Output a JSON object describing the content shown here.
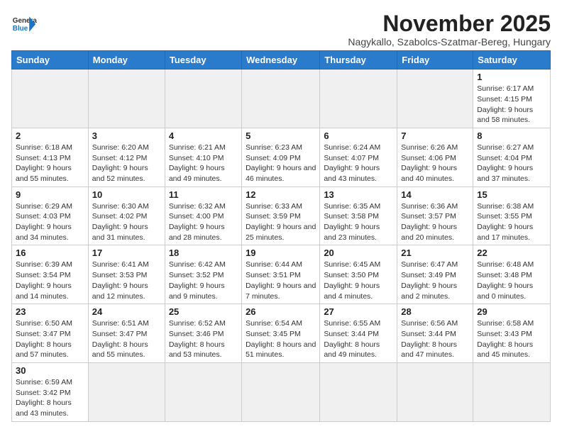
{
  "logo": {
    "text_general": "General",
    "text_blue": "Blue"
  },
  "title": "November 2025",
  "subtitle": "Nagykallo, Szabolcs-Szatmar-Bereg, Hungary",
  "weekdays": [
    "Sunday",
    "Monday",
    "Tuesday",
    "Wednesday",
    "Thursday",
    "Friday",
    "Saturday"
  ],
  "weeks": [
    [
      {
        "day": "",
        "info": ""
      },
      {
        "day": "",
        "info": ""
      },
      {
        "day": "",
        "info": ""
      },
      {
        "day": "",
        "info": ""
      },
      {
        "day": "",
        "info": ""
      },
      {
        "day": "",
        "info": ""
      },
      {
        "day": "1",
        "info": "Sunrise: 6:17 AM\nSunset: 4:15 PM\nDaylight: 9 hours and 58 minutes."
      }
    ],
    [
      {
        "day": "2",
        "info": "Sunrise: 6:18 AM\nSunset: 4:13 PM\nDaylight: 9 hours and 55 minutes."
      },
      {
        "day": "3",
        "info": "Sunrise: 6:20 AM\nSunset: 4:12 PM\nDaylight: 9 hours and 52 minutes."
      },
      {
        "day": "4",
        "info": "Sunrise: 6:21 AM\nSunset: 4:10 PM\nDaylight: 9 hours and 49 minutes."
      },
      {
        "day": "5",
        "info": "Sunrise: 6:23 AM\nSunset: 4:09 PM\nDaylight: 9 hours and 46 minutes."
      },
      {
        "day": "6",
        "info": "Sunrise: 6:24 AM\nSunset: 4:07 PM\nDaylight: 9 hours and 43 minutes."
      },
      {
        "day": "7",
        "info": "Sunrise: 6:26 AM\nSunset: 4:06 PM\nDaylight: 9 hours and 40 minutes."
      },
      {
        "day": "8",
        "info": "Sunrise: 6:27 AM\nSunset: 4:04 PM\nDaylight: 9 hours and 37 minutes."
      }
    ],
    [
      {
        "day": "9",
        "info": "Sunrise: 6:29 AM\nSunset: 4:03 PM\nDaylight: 9 hours and 34 minutes."
      },
      {
        "day": "10",
        "info": "Sunrise: 6:30 AM\nSunset: 4:02 PM\nDaylight: 9 hours and 31 minutes."
      },
      {
        "day": "11",
        "info": "Sunrise: 6:32 AM\nSunset: 4:00 PM\nDaylight: 9 hours and 28 minutes."
      },
      {
        "day": "12",
        "info": "Sunrise: 6:33 AM\nSunset: 3:59 PM\nDaylight: 9 hours and 25 minutes."
      },
      {
        "day": "13",
        "info": "Sunrise: 6:35 AM\nSunset: 3:58 PM\nDaylight: 9 hours and 23 minutes."
      },
      {
        "day": "14",
        "info": "Sunrise: 6:36 AM\nSunset: 3:57 PM\nDaylight: 9 hours and 20 minutes."
      },
      {
        "day": "15",
        "info": "Sunrise: 6:38 AM\nSunset: 3:55 PM\nDaylight: 9 hours and 17 minutes."
      }
    ],
    [
      {
        "day": "16",
        "info": "Sunrise: 6:39 AM\nSunset: 3:54 PM\nDaylight: 9 hours and 14 minutes."
      },
      {
        "day": "17",
        "info": "Sunrise: 6:41 AM\nSunset: 3:53 PM\nDaylight: 9 hours and 12 minutes."
      },
      {
        "day": "18",
        "info": "Sunrise: 6:42 AM\nSunset: 3:52 PM\nDaylight: 9 hours and 9 minutes."
      },
      {
        "day": "19",
        "info": "Sunrise: 6:44 AM\nSunset: 3:51 PM\nDaylight: 9 hours and 7 minutes."
      },
      {
        "day": "20",
        "info": "Sunrise: 6:45 AM\nSunset: 3:50 PM\nDaylight: 9 hours and 4 minutes."
      },
      {
        "day": "21",
        "info": "Sunrise: 6:47 AM\nSunset: 3:49 PM\nDaylight: 9 hours and 2 minutes."
      },
      {
        "day": "22",
        "info": "Sunrise: 6:48 AM\nSunset: 3:48 PM\nDaylight: 9 hours and 0 minutes."
      }
    ],
    [
      {
        "day": "23",
        "info": "Sunrise: 6:50 AM\nSunset: 3:47 PM\nDaylight: 8 hours and 57 minutes."
      },
      {
        "day": "24",
        "info": "Sunrise: 6:51 AM\nSunset: 3:47 PM\nDaylight: 8 hours and 55 minutes."
      },
      {
        "day": "25",
        "info": "Sunrise: 6:52 AM\nSunset: 3:46 PM\nDaylight: 8 hours and 53 minutes."
      },
      {
        "day": "26",
        "info": "Sunrise: 6:54 AM\nSunset: 3:45 PM\nDaylight: 8 hours and 51 minutes."
      },
      {
        "day": "27",
        "info": "Sunrise: 6:55 AM\nSunset: 3:44 PM\nDaylight: 8 hours and 49 minutes."
      },
      {
        "day": "28",
        "info": "Sunrise: 6:56 AM\nSunset: 3:44 PM\nDaylight: 8 hours and 47 minutes."
      },
      {
        "day": "29",
        "info": "Sunrise: 6:58 AM\nSunset: 3:43 PM\nDaylight: 8 hours and 45 minutes."
      }
    ],
    [
      {
        "day": "30",
        "info": "Sunrise: 6:59 AM\nSunset: 3:42 PM\nDaylight: 8 hours and 43 minutes."
      },
      {
        "day": "",
        "info": ""
      },
      {
        "day": "",
        "info": ""
      },
      {
        "day": "",
        "info": ""
      },
      {
        "day": "",
        "info": ""
      },
      {
        "day": "",
        "info": ""
      },
      {
        "day": "",
        "info": ""
      }
    ]
  ]
}
